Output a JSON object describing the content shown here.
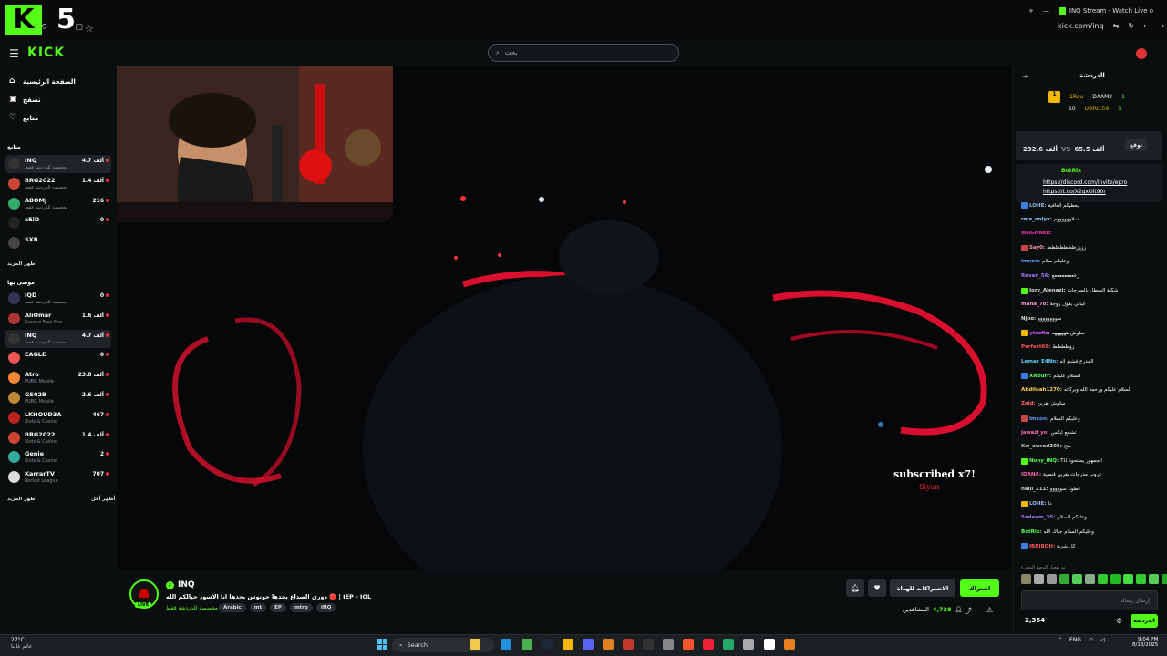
{
  "browser": {
    "tab_title": "INQ Stream - Watch Live o",
    "url": "kick.com/inq",
    "logo_letter": "K",
    "logo_number": "5"
  },
  "header": {
    "search_placeholder": "بحث"
  },
  "sidebar": {
    "nav": [
      {
        "label": "الصفحة الرئيسية",
        "icon": "home-icon"
      },
      {
        "label": "تصفح",
        "icon": "browse-icon"
      },
      {
        "label": "متابع",
        "icon": "heart-icon"
      }
    ],
    "following_title": "متابع",
    "following": [
      {
        "name": "INQ",
        "sub": "مخصصة للدردشة فقط",
        "count": "4.7 ألف",
        "color": "#333"
      },
      {
        "name": "BRG2022",
        "sub": "مخصصة للدردشة فقط",
        "count": "1.4 ألف",
        "color": "#c43"
      },
      {
        "name": "ABOMJ",
        "sub": "مخصصة للدردشة فقط",
        "count": "216",
        "color": "#3a6"
      },
      {
        "name": "xEiD",
        "sub": "",
        "count": "0",
        "color": "#222"
      },
      {
        "name": "SXB",
        "sub": "",
        "count": "",
        "color": "#444"
      }
    ],
    "show_more_1": "أظهر المزيد",
    "recommended_title": "موصى بها",
    "recommended": [
      {
        "name": "IQD",
        "sub": "مخصصة للدردشة فقط",
        "count": "0",
        "color": "#335"
      },
      {
        "name": "AliOmar",
        "sub": "Garena Free Fire",
        "count": "1.6 ألف",
        "color": "#a33"
      },
      {
        "name": "INQ",
        "sub": "مخصصة للدردشة فقط",
        "count": "4.7 ألف",
        "color": "#333"
      },
      {
        "name": "EAGLE",
        "sub": "",
        "count": "0",
        "color": "#e55"
      },
      {
        "name": "Atro",
        "sub": "PUBG Mobile",
        "count": "23.8 ألف",
        "color": "#e83"
      },
      {
        "name": "GS02B",
        "sub": "PUBG Mobile",
        "count": "2.6 ألف",
        "color": "#b83"
      },
      {
        "name": "LKHOUD3A",
        "sub": "Slots & Casino",
        "count": "467",
        "color": "#b22"
      },
      {
        "name": "BRG2022",
        "sub": "Slots & Casino",
        "count": "1.4 ألف",
        "color": "#c43"
      },
      {
        "name": "Genie",
        "sub": "Slots & Casino",
        "count": "2",
        "color": "#3a9"
      },
      {
        "name": "KarrarTV",
        "sub": "Rocket League",
        "count": "707",
        "color": "#ddd"
      }
    ],
    "show_more_2": "أظهر المزيد",
    "show_less": "أظهر أقل"
  },
  "video": {
    "overlay_text": "subscribed x7!",
    "overlay_name": "Siyan"
  },
  "stream": {
    "name": "INQ",
    "title": "دوري الصداع بحدها حوتوس بحدها انا الاسود حيالكم الله 🔴 | IEP - IOL",
    "category": "مخصصة للدردشة فقط",
    "tags": [
      "Arabic",
      "mt",
      "EP",
      "mtrp",
      "INQ"
    ],
    "subscribe_label": "اشتراك",
    "gift_label": "الاشتراكات للهداة",
    "viewers_label": "المشاهدين",
    "viewers_count": "4,728",
    "live": "LIVE"
  },
  "chat": {
    "title": "الدردشة",
    "leaderboard": [
      {
        "rank": "1",
        "name": "1Reu",
        "points": "10"
      },
      {
        "name": "DAAM2",
        "points": "1"
      },
      {
        "name": "UORI159",
        "points": "1"
      }
    ],
    "prediction": {
      "label": "توقع",
      "left": "65.5 ألف",
      "vs": "VS",
      "right": "232.6 ألف"
    },
    "pinned_user": "BotRix",
    "pinned_link_1": "https://discord.com/invite/epro",
    "pinned_link_2": "https://t.co/X2gxOlt90r",
    "messages": [
      {
        "user": "LOHE:",
        "text": "يعطيكم العافية",
        "color": "#9be"
      },
      {
        "user": "rma_onlyy:",
        "text": "سلاووووووم",
        "color": "#8cf"
      },
      {
        "user": "WAGHNER:",
        "text": "",
        "color": "#e3a"
      },
      {
        "user": "Say0:",
        "text": "ززززظظظظظظظ",
        "color": "#f9a"
      },
      {
        "user": "lmxon:",
        "text": "وعليكم سلام",
        "color": "#69f"
      },
      {
        "user": "Revan_56:",
        "text": "زعععععععععع",
        "color": "#a7f"
      },
      {
        "user": "Jory_Alenazi:",
        "text": "شكلة السطل بالسرحات",
        "color": "#ddd"
      },
      {
        "user": "maha_78:",
        "text": "عيالي يقول زوجة",
        "color": "#f9c"
      },
      {
        "user": "Njoo:",
        "text": "سوووووووو",
        "color": "#ddd"
      },
      {
        "user": "ytezfiz:",
        "text": "سلوش ههههههه",
        "color": "#c5f"
      },
      {
        "user": "Perfect69:",
        "text": "زوطططط",
        "color": "#f55"
      },
      {
        "user": "Lamar_E4Nn:",
        "text": "المدرج فشنو اثه",
        "color": "#6cf"
      },
      {
        "user": "XNourr:",
        "text": "السلام عليكم",
        "color": "#5f5"
      },
      {
        "user": "Abdiluah1270:",
        "text": "السلام عليكم ورحمة الله وبركاته",
        "color": "#fc5"
      },
      {
        "user": "Zaid:",
        "text": "سلوش بقرين",
        "color": "#f66"
      },
      {
        "user": "lmxon:",
        "text": "وعليكم السلام",
        "color": "#69f"
      },
      {
        "user": "jawad_yo:",
        "text": "تشجع ايكس",
        "color": "#f6a"
      },
      {
        "user": "Kw_awrad305:",
        "text": "صح",
        "color": "#ccc"
      },
      {
        "user": "Nony_INQ:",
        "text": "TU الجمهور يستحوذ",
        "color": "#5f5"
      },
      {
        "user": "IDANA:",
        "text": "عروب مدرجات بقرين قنصية",
        "color": "#f6a"
      },
      {
        "user": "halil_211:",
        "text": "عطونا سووووو",
        "color": "#ccc"
      },
      {
        "user": "LOHE:",
        "text": "دا",
        "color": "#9be"
      },
      {
        "user": "Sadeem_35:",
        "text": "وعليكم السلام",
        "color": "#a7f"
      },
      {
        "user": "BotRix:",
        "text": "وعليكم السلام حياك الله",
        "color": "#5f5"
      },
      {
        "user": "IBBIBQH:",
        "text": "كل شيء",
        "color": "#f55"
      }
    ],
    "emote_hint": "تم تفعيل الوضع البطيء",
    "input_placeholder": "إرسال رسالة",
    "send_label": "الدردشة",
    "points": "2,354"
  },
  "taskbar": {
    "temp": "27°C",
    "weather": "غائم غالبا",
    "search": "Search",
    "lang": "ENG",
    "time": "9:04 PM",
    "date": "8/13/2025"
  }
}
